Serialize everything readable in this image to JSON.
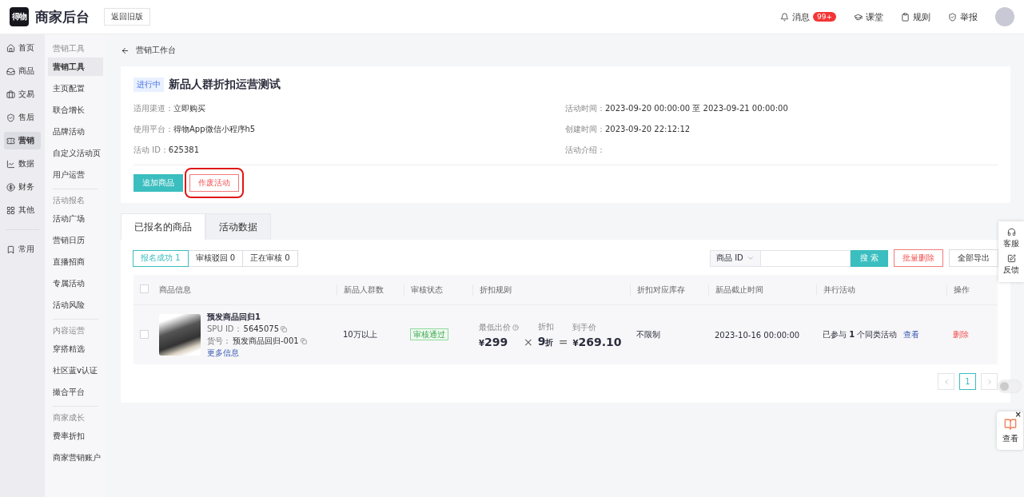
{
  "header": {
    "logo_mark": "得物",
    "title": "商家后台",
    "back_button": "返回旧版",
    "actions": [
      {
        "label": "消息",
        "badge": "99+"
      },
      {
        "label": "课堂"
      },
      {
        "label": "规则"
      },
      {
        "label": "举报"
      }
    ]
  },
  "nav": {
    "items": [
      {
        "label": "首页",
        "selected": false
      },
      {
        "label": "商品",
        "selected": false
      },
      {
        "label": "交易",
        "selected": false
      },
      {
        "label": "售后",
        "selected": false
      },
      {
        "label": "营销",
        "selected": true
      },
      {
        "label": "数据",
        "selected": false
      },
      {
        "label": "财务",
        "selected": false
      },
      {
        "label": "其他",
        "selected": false
      }
    ],
    "pinned": [
      {
        "label": "常用",
        "selected": false
      }
    ]
  },
  "subnav": [
    {
      "heading": "营销工具",
      "items": [
        {
          "label": "营销工具",
          "selected": true
        },
        {
          "label": "主页配置",
          "selected": false
        },
        {
          "label": "联合增长",
          "selected": false
        },
        {
          "label": "品牌活动",
          "selected": false
        },
        {
          "label": "自定义活动页",
          "selected": false
        },
        {
          "label": "用户运营",
          "selected": false
        }
      ]
    },
    {
      "heading": "活动报名",
      "items": [
        {
          "label": "活动广场",
          "selected": false
        },
        {
          "label": "营销日历",
          "selected": false
        },
        {
          "label": "直播招商",
          "selected": false
        },
        {
          "label": "专属活动",
          "selected": false
        },
        {
          "label": "活动风险",
          "selected": false
        }
      ]
    },
    {
      "heading": "内容运营",
      "items": [
        {
          "label": "穿搭精选",
          "selected": false
        },
        {
          "label": "社区蓝v认证",
          "selected": false
        },
        {
          "label": "撮合平台",
          "selected": false
        }
      ]
    },
    {
      "heading": "商家成长",
      "items": [
        {
          "label": "费率折扣",
          "selected": false
        },
        {
          "label": "商家营销账户",
          "selected": false
        }
      ]
    }
  ],
  "breadcrumb": "营销工作台",
  "activity": {
    "status": "进行中",
    "title": "新品人群折扣运营测试",
    "fields_left": [
      {
        "label": "适用渠道：",
        "value": "立即购买"
      },
      {
        "label": "使用平台：",
        "value": "得物App微信小程序h5"
      },
      {
        "label": "活动 ID：",
        "value": "625381"
      }
    ],
    "fields_right": [
      {
        "label": "活动时间：",
        "value": "2023-09-20 00:00:00 至 2023-09-21 00:00:00"
      },
      {
        "label": "创建时间：",
        "value": "2023-09-20 22:12:12"
      },
      {
        "label": "活动介绍："
      }
    ],
    "buttons": [
      {
        "label": "追加商品",
        "kind": "primary",
        "highlighted": false
      },
      {
        "label": "作废活动",
        "kind": "danger",
        "highlighted": true
      }
    ]
  },
  "tabs": [
    {
      "label": "已报名的商品",
      "selected": true
    },
    {
      "label": "活动数据",
      "selected": false
    }
  ],
  "filters": [
    {
      "label": "报名成功 1",
      "selected": true
    },
    {
      "label": "审核驳回 0",
      "selected": false
    },
    {
      "label": "正在审核 0",
      "selected": false
    }
  ],
  "search": {
    "field_select": "商品 ID",
    "button": "搜 索"
  },
  "toolbar_buttons": [
    {
      "label": "批量删除",
      "kind": "danger"
    },
    {
      "label": "全部导出",
      "kind": "default"
    }
  ],
  "table": {
    "all_checked": false,
    "columns": [
      "商品信息",
      "新品人群数",
      "审核状态",
      "折扣规则",
      "折扣对应库存",
      "新品截止时间",
      "并行活动",
      "操作"
    ],
    "rows": [
      {
        "checked": false,
        "name": "预发商品回归1",
        "spu_label": "SPU ID：",
        "spu": "5645075",
        "sku_label": "货号：",
        "sku": "预发商品回归-001",
        "more": "更多信息",
        "audience": "10万以上",
        "review": "审核通过",
        "min_price_label": "最低出价",
        "currency": "¥",
        "min_price": "299",
        "times": "×",
        "discount_label": "折扣",
        "discount": "9",
        "discount_unit": "折",
        "equals": "=",
        "final_label": "到手价",
        "final_currency": "¥",
        "final_price": "269.10",
        "stock": "不限制",
        "deadline": "2023-10-16 00:00:00",
        "parallel": "已参与 **1** 个同类活动",
        "parallel_link": "查看",
        "action": "删除"
      }
    ]
  },
  "pagination": {
    "pages": [
      {
        "label": "1",
        "selected": true
      }
    ]
  },
  "float_panel": [
    {
      "label": "客服"
    },
    {
      "label": "反馈"
    }
  ],
  "toggle": {
    "on": false
  },
  "float_card": {
    "label": "查看",
    "close": "×"
  }
}
